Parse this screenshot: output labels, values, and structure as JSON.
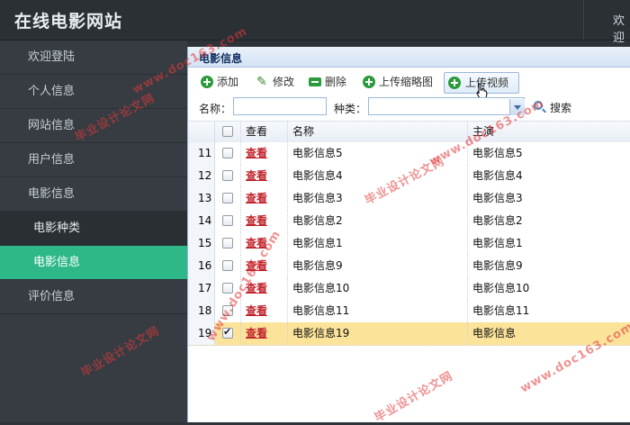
{
  "header": {
    "title": "在线电影网站",
    "right_text": "欢迎"
  },
  "sidebar": {
    "items": [
      {
        "label": "欢迎登陆"
      },
      {
        "label": "个人信息"
      },
      {
        "label": "网站信息"
      },
      {
        "label": "用户信息"
      },
      {
        "label": "电影信息"
      },
      {
        "label": "电影种类"
      },
      {
        "label": "电影信息"
      },
      {
        "label": "评价信息"
      }
    ]
  },
  "panel": {
    "title": "电影信息"
  },
  "toolbar": {
    "add": "添加",
    "edit": "修改",
    "delete": "删除",
    "upload_thumb": "上传缩略图",
    "upload_video": "上传视频"
  },
  "search": {
    "name_label": "名称：",
    "type_label": "种类：",
    "name_value": "",
    "type_value": "",
    "search_label": "搜索"
  },
  "grid": {
    "columns": {
      "view": "查看",
      "name": "名称",
      "actor": "主演"
    },
    "rows": [
      {
        "num": "11",
        "view": "查看",
        "name": "电影信息5",
        "actor": "电影信息5",
        "checked": false
      },
      {
        "num": "12",
        "view": "查看",
        "name": "电影信息4",
        "actor": "电影信息4",
        "checked": false
      },
      {
        "num": "13",
        "view": "查看",
        "name": "电影信息3",
        "actor": "电影信息3",
        "checked": false
      },
      {
        "num": "14",
        "view": "查看",
        "name": "电影信息2",
        "actor": "电影信息2",
        "checked": false
      },
      {
        "num": "15",
        "view": "查看",
        "name": "电影信息1",
        "actor": "电影信息1",
        "checked": false
      },
      {
        "num": "16",
        "view": "查看",
        "name": "电影信息9",
        "actor": "电影信息9",
        "checked": false
      },
      {
        "num": "17",
        "view": "查看",
        "name": "电影信息10",
        "actor": "电影信息10",
        "checked": false
      },
      {
        "num": "18",
        "view": "查看",
        "name": "电影信息11",
        "actor": "电影信息11",
        "checked": false
      },
      {
        "num": "19",
        "view": "查看",
        "name": "电影信息19",
        "actor": "电影信息",
        "checked": true
      }
    ]
  },
  "watermarks": {
    "text1": "毕业设计论文网",
    "text2": "www.doc163.com"
  }
}
